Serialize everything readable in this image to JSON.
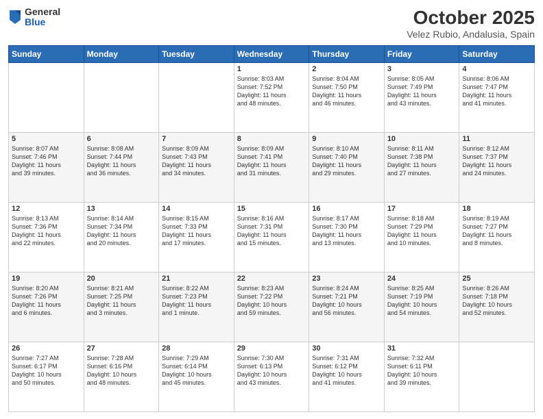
{
  "header": {
    "logo": {
      "general": "General",
      "blue": "Blue"
    },
    "month": "October 2025",
    "location": "Velez Rubio, Andalusia, Spain"
  },
  "weekdays": [
    "Sunday",
    "Monday",
    "Tuesday",
    "Wednesday",
    "Thursday",
    "Friday",
    "Saturday"
  ],
  "weeks": [
    [
      {
        "day": "",
        "info": ""
      },
      {
        "day": "",
        "info": ""
      },
      {
        "day": "",
        "info": ""
      },
      {
        "day": "1",
        "info": "Sunrise: 8:03 AM\nSunset: 7:52 PM\nDaylight: 11 hours\nand 48 minutes."
      },
      {
        "day": "2",
        "info": "Sunrise: 8:04 AM\nSunset: 7:50 PM\nDaylight: 11 hours\nand 46 minutes."
      },
      {
        "day": "3",
        "info": "Sunrise: 8:05 AM\nSunset: 7:49 PM\nDaylight: 11 hours\nand 43 minutes."
      },
      {
        "day": "4",
        "info": "Sunrise: 8:06 AM\nSunset: 7:47 PM\nDaylight: 11 hours\nand 41 minutes."
      }
    ],
    [
      {
        "day": "5",
        "info": "Sunrise: 8:07 AM\nSunset: 7:46 PM\nDaylight: 11 hours\nand 39 minutes."
      },
      {
        "day": "6",
        "info": "Sunrise: 8:08 AM\nSunset: 7:44 PM\nDaylight: 11 hours\nand 36 minutes."
      },
      {
        "day": "7",
        "info": "Sunrise: 8:09 AM\nSunset: 7:43 PM\nDaylight: 11 hours\nand 34 minutes."
      },
      {
        "day": "8",
        "info": "Sunrise: 8:09 AM\nSunset: 7:41 PM\nDaylight: 11 hours\nand 31 minutes."
      },
      {
        "day": "9",
        "info": "Sunrise: 8:10 AM\nSunset: 7:40 PM\nDaylight: 11 hours\nand 29 minutes."
      },
      {
        "day": "10",
        "info": "Sunrise: 8:11 AM\nSunset: 7:38 PM\nDaylight: 11 hours\nand 27 minutes."
      },
      {
        "day": "11",
        "info": "Sunrise: 8:12 AM\nSunset: 7:37 PM\nDaylight: 11 hours\nand 24 minutes."
      }
    ],
    [
      {
        "day": "12",
        "info": "Sunrise: 8:13 AM\nSunset: 7:36 PM\nDaylight: 11 hours\nand 22 minutes."
      },
      {
        "day": "13",
        "info": "Sunrise: 8:14 AM\nSunset: 7:34 PM\nDaylight: 11 hours\nand 20 minutes."
      },
      {
        "day": "14",
        "info": "Sunrise: 8:15 AM\nSunset: 7:33 PM\nDaylight: 11 hours\nand 17 minutes."
      },
      {
        "day": "15",
        "info": "Sunrise: 8:16 AM\nSunset: 7:31 PM\nDaylight: 11 hours\nand 15 minutes."
      },
      {
        "day": "16",
        "info": "Sunrise: 8:17 AM\nSunset: 7:30 PM\nDaylight: 11 hours\nand 13 minutes."
      },
      {
        "day": "17",
        "info": "Sunrise: 8:18 AM\nSunset: 7:29 PM\nDaylight: 11 hours\nand 10 minutes."
      },
      {
        "day": "18",
        "info": "Sunrise: 8:19 AM\nSunset: 7:27 PM\nDaylight: 11 hours\nand 8 minutes."
      }
    ],
    [
      {
        "day": "19",
        "info": "Sunrise: 8:20 AM\nSunset: 7:26 PM\nDaylight: 11 hours\nand 6 minutes."
      },
      {
        "day": "20",
        "info": "Sunrise: 8:21 AM\nSunset: 7:25 PM\nDaylight: 11 hours\nand 3 minutes."
      },
      {
        "day": "21",
        "info": "Sunrise: 8:22 AM\nSunset: 7:23 PM\nDaylight: 11 hours\nand 1 minute."
      },
      {
        "day": "22",
        "info": "Sunrise: 8:23 AM\nSunset: 7:22 PM\nDaylight: 10 hours\nand 59 minutes."
      },
      {
        "day": "23",
        "info": "Sunrise: 8:24 AM\nSunset: 7:21 PM\nDaylight: 10 hours\nand 56 minutes."
      },
      {
        "day": "24",
        "info": "Sunrise: 8:25 AM\nSunset: 7:19 PM\nDaylight: 10 hours\nand 54 minutes."
      },
      {
        "day": "25",
        "info": "Sunrise: 8:26 AM\nSunset: 7:18 PM\nDaylight: 10 hours\nand 52 minutes."
      }
    ],
    [
      {
        "day": "26",
        "info": "Sunrise: 7:27 AM\nSunset: 6:17 PM\nDaylight: 10 hours\nand 50 minutes."
      },
      {
        "day": "27",
        "info": "Sunrise: 7:28 AM\nSunset: 6:16 PM\nDaylight: 10 hours\nand 48 minutes."
      },
      {
        "day": "28",
        "info": "Sunrise: 7:29 AM\nSunset: 6:14 PM\nDaylight: 10 hours\nand 45 minutes."
      },
      {
        "day": "29",
        "info": "Sunrise: 7:30 AM\nSunset: 6:13 PM\nDaylight: 10 hours\nand 43 minutes."
      },
      {
        "day": "30",
        "info": "Sunrise: 7:31 AM\nSunset: 6:12 PM\nDaylight: 10 hours\nand 41 minutes."
      },
      {
        "day": "31",
        "info": "Sunrise: 7:32 AM\nSunset: 6:11 PM\nDaylight: 10 hours\nand 39 minutes."
      },
      {
        "day": "",
        "info": ""
      }
    ]
  ]
}
